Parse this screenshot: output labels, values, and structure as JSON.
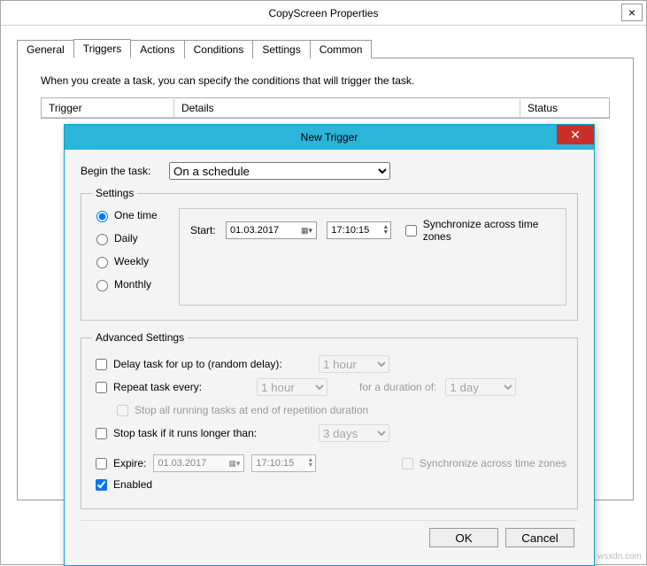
{
  "parent": {
    "title": "CopyScreen Properties",
    "tabs": {
      "general": "General",
      "triggers": "Triggers",
      "actions": "Actions",
      "conditions": "Conditions",
      "settings": "Settings",
      "common": "Common"
    },
    "desc": "When you create a task, you can specify the conditions that will trigger the task.",
    "columns": {
      "trigger": "Trigger",
      "details": "Details",
      "status": "Status"
    }
  },
  "dialog": {
    "title": "New Trigger",
    "begin_label": "Begin the task:",
    "begin_value": "On a schedule",
    "settings_legend": "Settings",
    "radios": {
      "one_time": "One time",
      "daily": "Daily",
      "weekly": "Weekly",
      "monthly": "Monthly"
    },
    "start_label": "Start:",
    "start_date": "01.03.2017",
    "start_time": "17:10:15",
    "sync_tz": "Synchronize across time zones",
    "adv_legend": "Advanced Settings",
    "delay_label": "Delay task for up to (random delay):",
    "delay_value": "1 hour",
    "repeat_label": "Repeat task every:",
    "repeat_value": "1 hour",
    "duration_label": "for a duration of:",
    "duration_value": "1 day",
    "stop_all_label": "Stop all running tasks at end of repetition duration",
    "stop_if_label": "Stop task if it runs longer than:",
    "stop_if_value": "3 days",
    "expire_label": "Expire:",
    "expire_date": "01.03.2017",
    "expire_time": "17:10:15",
    "expire_sync": "Synchronize across time zones",
    "enabled_label": "Enabled",
    "ok": "OK",
    "cancel": "Cancel"
  },
  "watermark": "wsxdn.com"
}
